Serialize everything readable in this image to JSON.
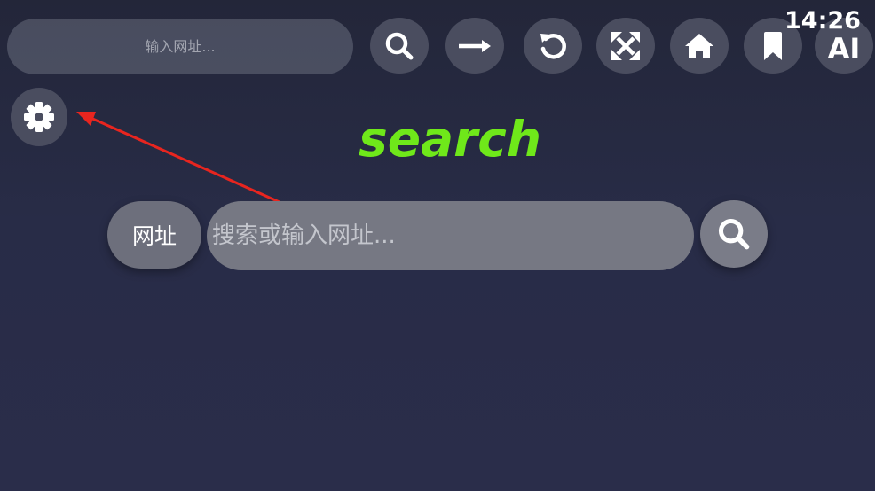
{
  "status_bar": {
    "time": "14:26"
  },
  "toolbar": {
    "url_placeholder": "输入网址...",
    "buttons": [
      {
        "name": "search-icon"
      },
      {
        "name": "arrow-right-icon"
      },
      {
        "name": "refresh-icon"
      },
      {
        "name": "fullscreen-icon"
      },
      {
        "name": "home-icon"
      },
      {
        "name": "bookmark-icon"
      }
    ],
    "ai_label": "AI"
  },
  "settings": {
    "icon": "gear-icon"
  },
  "logo": {
    "text": "search",
    "color": "#6fe81a"
  },
  "search_box": {
    "engine_label": "网址",
    "placeholder": "搜索或输入网址...",
    "submit_icon": "search-icon"
  },
  "annotation": {
    "arrow_color": "#e8251f"
  }
}
